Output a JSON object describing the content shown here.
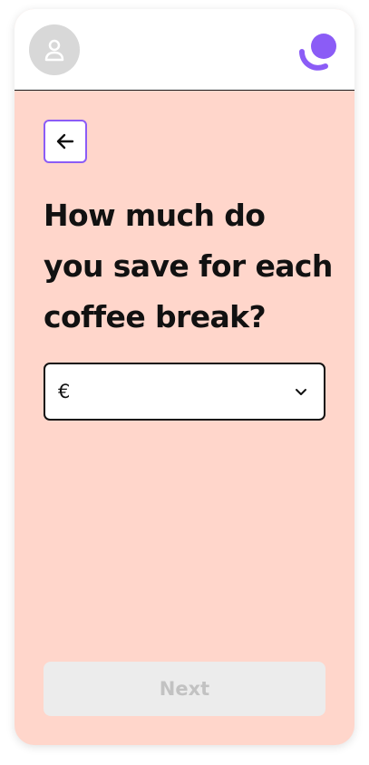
{
  "header": {
    "avatar_icon": "user-icon",
    "logo_icon": "brand-logo"
  },
  "back": {
    "icon": "arrow-left-icon"
  },
  "question": {
    "text": "How much do you save for each coffee break?"
  },
  "amount": {
    "currency_symbol": "€",
    "value": "",
    "icon": "chevron-down-icon"
  },
  "footer": {
    "next_label": "Next",
    "next_disabled": true
  },
  "colors": {
    "background": "#ffd6cb",
    "accent": "#8b5cf6",
    "text": "#111111",
    "disabled_bg": "#ececec",
    "disabled_text": "#c2c2c2"
  }
}
